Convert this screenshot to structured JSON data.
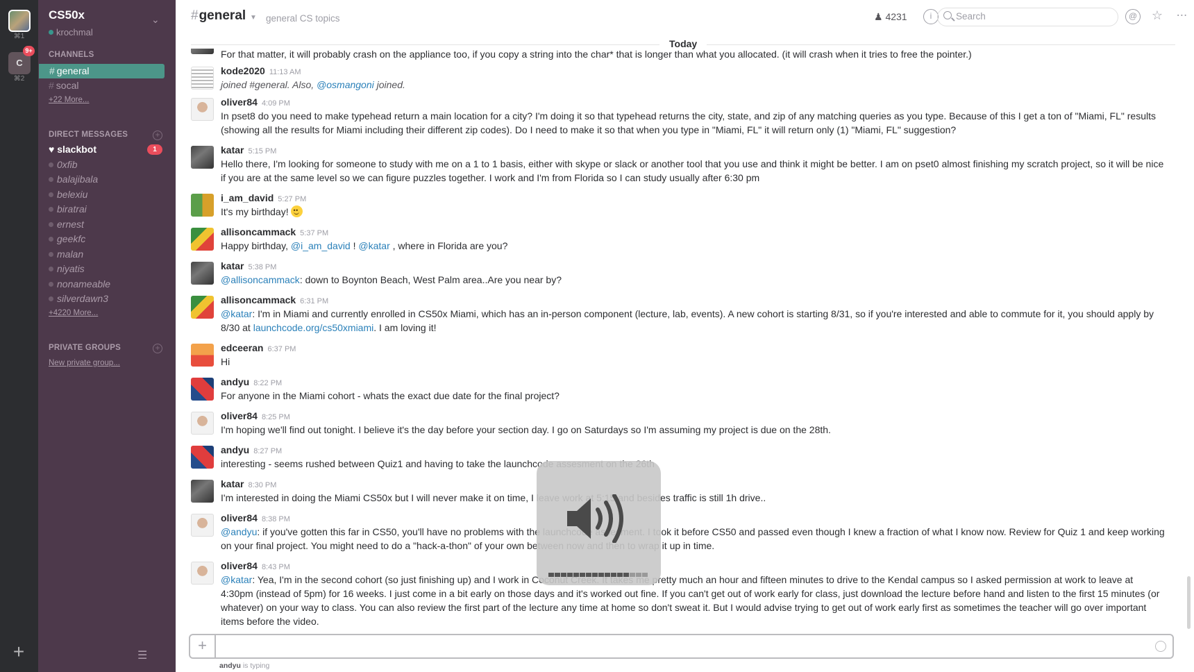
{
  "rail": {
    "team2_letter": "C",
    "team1_shortcut": "⌘1",
    "team2_shortcut": "⌘2",
    "team2_badge": "9+",
    "add_icon": "+"
  },
  "sidebar": {
    "team_name": "CS50x",
    "user": "krochmal",
    "channels_header": "CHANNELS",
    "channels": [
      {
        "name": "general",
        "active": true
      },
      {
        "name": "socal",
        "active": false
      }
    ],
    "channels_more": "+22 More...",
    "dm_header": "DIRECT MESSAGES",
    "dms": [
      {
        "name": "slackbot",
        "badge": "1"
      },
      {
        "name": "0xfib"
      },
      {
        "name": "balajibala"
      },
      {
        "name": "belexiu"
      },
      {
        "name": "biratrai"
      },
      {
        "name": "ernest"
      },
      {
        "name": "geekfc"
      },
      {
        "name": "malan"
      },
      {
        "name": "niyatis"
      },
      {
        "name": "nonameable"
      },
      {
        "name": "silverdawn3"
      }
    ],
    "dms_more": "+4220 More...",
    "groups_header": "PRIVATE GROUPS",
    "new_group": "New private group..."
  },
  "header": {
    "channel": "general",
    "topic": "general CS topics",
    "member_count": "4231",
    "search_placeholder": "Search"
  },
  "day_label": "Today",
  "messages": [
    {
      "author": "",
      "time": "",
      "body": "For that matter, it will probably crash on the appliance too, if you copy a string into the char* that is longer than what you allocated.  (it will crash when it tries to free the pointer.)"
    },
    {
      "author": "kode2020",
      "time": "11:13 AM",
      "body_pre": "joined #general. Also, ",
      "mention": "@osmangoni",
      "body_post": " joined."
    },
    {
      "author": "oliver84",
      "time": "4:09 PM",
      "body": "In pset8 do you need to make typehead return a main location for a city? I'm doing it so that typehead returns the city, state, and zip of any matching queries as you type. Because of this I get a ton of \"Miami, FL\" results (showing all the results for Miami including their different zip codes). Do I need to make it so that when you type in \"Miami, FL\" it will return only (1) \"Miami, FL\" suggestion?"
    },
    {
      "author": "katar",
      "time": "5:15 PM",
      "body": "Hello there, I'm looking for someone to study with me on a 1 to 1 basis, either with skype or slack or another tool that you use and think it might be better. I am on pset0 almost finishing my scratch project, so it will be nice if you are at the same level so we can figure puzzles together.  I work and I'm from Florida so I can study usually after 6:30 pm"
    },
    {
      "author": "i_am_david",
      "time": "5:27 PM",
      "body": "It's my birthday! "
    },
    {
      "author": "allisoncammack",
      "time": "5:37 PM",
      "body_pre": "Happy birthday, ",
      "mention": "@i_am_david",
      "body_mid": " ! ",
      "mention2": "@katar",
      "body_post": " , where in Florida are you?"
    },
    {
      "author": "katar",
      "time": "5:38 PM",
      "mention": "@allisoncammack",
      "body_post": ":  down to Boynton Beach, West Palm area..Are you near by?"
    },
    {
      "author": "allisoncammack",
      "time": "6:31 PM",
      "mention": "@katar",
      "body_post": ": I'm in Miami and currently enrolled in CS50x Miami, which has an in-person component (lecture, lab, events). A new cohort is starting 8/31, so if you're interested and able to commute for it, you should apply by 8/30 at ",
      "link": "launchcode.org/cs50xmiami",
      "body_end": ". I am loving it!"
    },
    {
      "author": "edceeran",
      "time": "6:37 PM",
      "body": "Hi"
    },
    {
      "author": "andyu",
      "time": "8:22 PM",
      "body": "For anyone in the Miami cohort - whats the exact due date for the final project?"
    },
    {
      "author": "oliver84",
      "time": "8:25 PM",
      "body": "I'm hoping we'll find out tonight. I believe it's the day before your section day. I go on Saturdays so I'm assuming my project is due on the 28th."
    },
    {
      "author": "andyu",
      "time": "8:27 PM",
      "body": "interesting - seems rushed between Quiz1 and having to take the launchcode assesment on the 26th"
    },
    {
      "author": "katar",
      "time": "8:30 PM",
      "body": "I'm interested in doing the Miami CS50x but I will never make it on time, I leave work at 5:15 and besides traffic is still 1h drive.."
    },
    {
      "author": "oliver84",
      "time": "8:38 PM",
      "mention": "@andyu",
      "body_post": ":  if you've gotten this far in CS50, you'll have no problems with the launchcode assesment. I took it before CS50 and passed even though I knew a fraction of what I know now. Review for Quiz 1 and keep working on your final project. You might need to do a \"hack-a-thon\" of your own between now  and then to wrap it up in time."
    },
    {
      "author": "oliver84",
      "time": "8:43 PM",
      "mention": "@katar",
      "body_post": ":  Yea, I'm in the second cohort (so just finishing up) and I work in Coconut Creek. It takes me pretty much an hour and fifteen minutes to drive to the Kendal campus so I asked permission at work to leave at 4:30pm (instead of 5pm) for 16 weeks. I just come in a bit early on those days and it's worked out fine. If you can't get out of work early for class, just download the lecture before hand and listen to the first 15 minutes (or whatever) on your way to class. You can also review the first part of the lecture any time at home so don't sweat it. But I would advise trying to get out of work early first as sometimes the teacher will go over important items before the video."
    }
  ],
  "volume_hud": {
    "level_fraction": 0.8
  },
  "composer": {
    "plus": "+"
  },
  "typing": {
    "user": "andyu",
    "text": " is typing"
  }
}
